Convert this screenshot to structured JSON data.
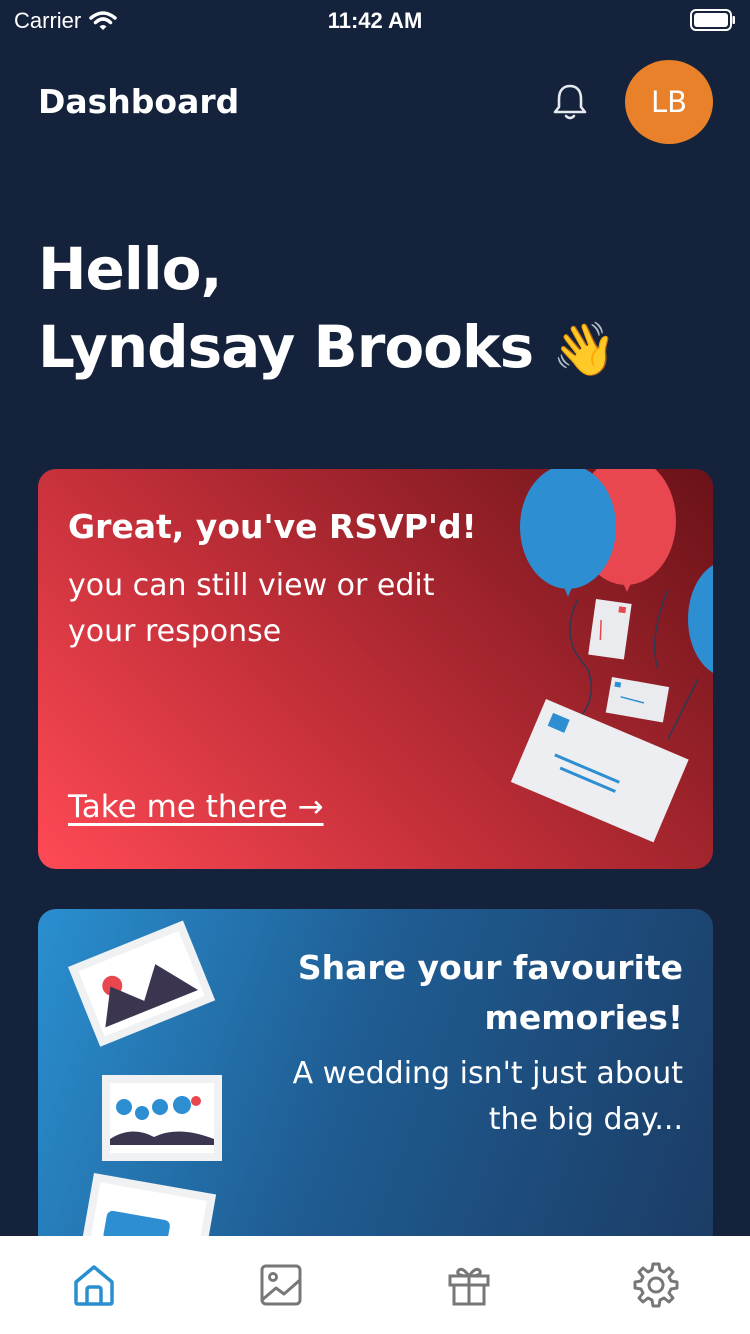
{
  "status_bar": {
    "carrier": "Carrier",
    "time": "11:42 AM"
  },
  "header": {
    "title": "Dashboard",
    "avatar_initials": "LB",
    "avatar_color": "#e8812a"
  },
  "greeting": {
    "line1": "Hello,",
    "name": "Lyndsay Brooks",
    "emoji": "👋"
  },
  "rsvp_card": {
    "title": "Great, you've RSVP'd!",
    "subtitle": "you can still view or edit your response",
    "link": "Take me there →"
  },
  "memories_card": {
    "title": "Share your favourite memories!",
    "subtitle": "A wedding isn't just about the big day..."
  },
  "tabbar": {
    "tabs": [
      {
        "icon": "home-icon",
        "active": true
      },
      {
        "icon": "image-icon",
        "active": false
      },
      {
        "icon": "gift-icon",
        "active": false
      },
      {
        "icon": "gear-icon",
        "active": false
      }
    ],
    "active_color": "#2a8fd0",
    "inactive_color": "#777777"
  }
}
